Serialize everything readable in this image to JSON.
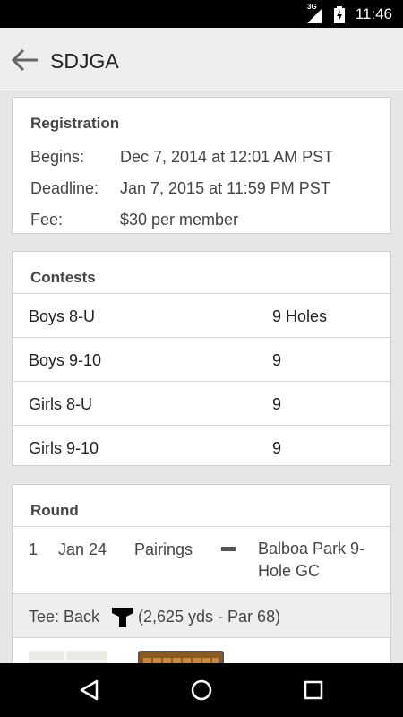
{
  "status_bar": {
    "network": "3G",
    "time": "11:46",
    "icons": [
      "signal-icon",
      "battery-icon"
    ]
  },
  "app_bar": {
    "title": "SDJGA",
    "back_icon": "arrow-left-icon"
  },
  "registration": {
    "title": "Registration",
    "rows": [
      {
        "label": "Begins:",
        "value": "Dec 7, 2014 at 12:01 AM PST"
      },
      {
        "label": "Deadline:",
        "value": "Jan 7, 2015 at 11:59 PM PST"
      },
      {
        "label": "Fee:",
        "value": "$30 per member"
      }
    ]
  },
  "contests": {
    "title": "Contests",
    "rows": [
      {
        "name": "Boys 8-U",
        "holes": "9 Holes"
      },
      {
        "name": "Boys 9-10",
        "holes": "9"
      },
      {
        "name": "Girls 8-U",
        "holes": "9"
      },
      {
        "name": "Girls 9-10",
        "holes": "9"
      }
    ]
  },
  "round": {
    "title": "Round",
    "number": "1",
    "date": "Jan 24",
    "pairings_label": "Pairings",
    "course": "Balboa Park 9-Hole GC",
    "tee_label": "Tee: Back",
    "tee_icon": "tee-marker-icon",
    "tee_color": "#000000",
    "tee_info": "(2,625 yds - Par 68)"
  },
  "nav_bar": {
    "icons": [
      "back-triangle-icon",
      "home-circle-icon",
      "recents-square-icon"
    ]
  }
}
